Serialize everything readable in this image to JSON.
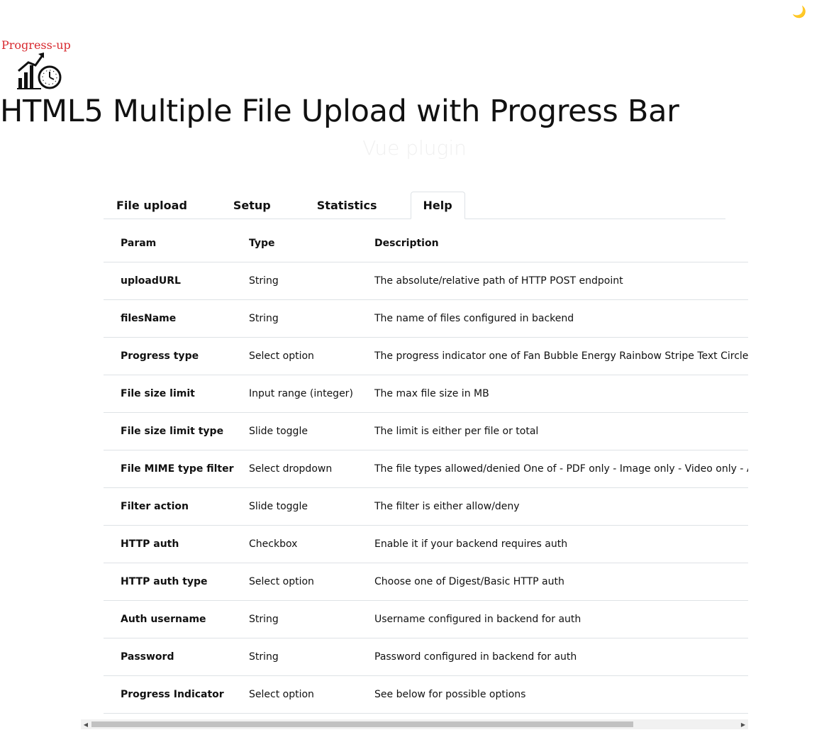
{
  "theme_toggle": {
    "icon": "moon-icon",
    "glyph": "🌙"
  },
  "logo": {
    "text": "Progress-up",
    "icon": "chart-clock-icon",
    "color": "#d8292f"
  },
  "header": {
    "title": "HTML5 Multiple File Upload with Progress Bar",
    "subtitle": "Vue plugin"
  },
  "tabs": [
    {
      "label": "File upload",
      "active": false
    },
    {
      "label": "Setup",
      "active": false
    },
    {
      "label": "Statistics",
      "active": false
    },
    {
      "label": "Help",
      "active": true
    }
  ],
  "table": {
    "columns": [
      "Param",
      "Type",
      "Description"
    ],
    "rows": [
      {
        "param": "uploadURL",
        "type": "String",
        "description": "The absolute/relative path of HTTP POST endpoint"
      },
      {
        "param": "filesName",
        "type": "String",
        "description": "The name of files configured in backend"
      },
      {
        "param": "Progress type",
        "type": "Select option",
        "description": "The progress indicator one of Fan Bubble Energy Rainbow Stripe Text Circle Line"
      },
      {
        "param": "File size limit",
        "type": "Input range (integer)",
        "description": "The max file size in MB"
      },
      {
        "param": "File size limit type",
        "type": "Slide toggle",
        "description": "The limit is either per file or total"
      },
      {
        "param": "File MIME type filter",
        "type": "Select dropdown",
        "description": "The file types allowed/denied One of - PDF only - Image only - Video only - Audio only"
      },
      {
        "param": "Filter action",
        "type": "Slide toggle",
        "description": "The filter is either allow/deny"
      },
      {
        "param": "HTTP auth",
        "type": "Checkbox",
        "description": "Enable it if your backend requires auth"
      },
      {
        "param": "HTTP auth type",
        "type": "Select option",
        "description": "Choose one of Digest/Basic HTTP auth"
      },
      {
        "param": "Auth username",
        "type": "String",
        "description": "Username configured in backend for auth"
      },
      {
        "param": "Password",
        "type": "String",
        "description": "Password configured in backend for auth"
      },
      {
        "param": "Progress Indicator",
        "type": "Select option",
        "description": "See below for possible options"
      }
    ]
  },
  "scrollbar": {
    "left_arrow": "◀",
    "right_arrow": "▶",
    "position": 0
  }
}
